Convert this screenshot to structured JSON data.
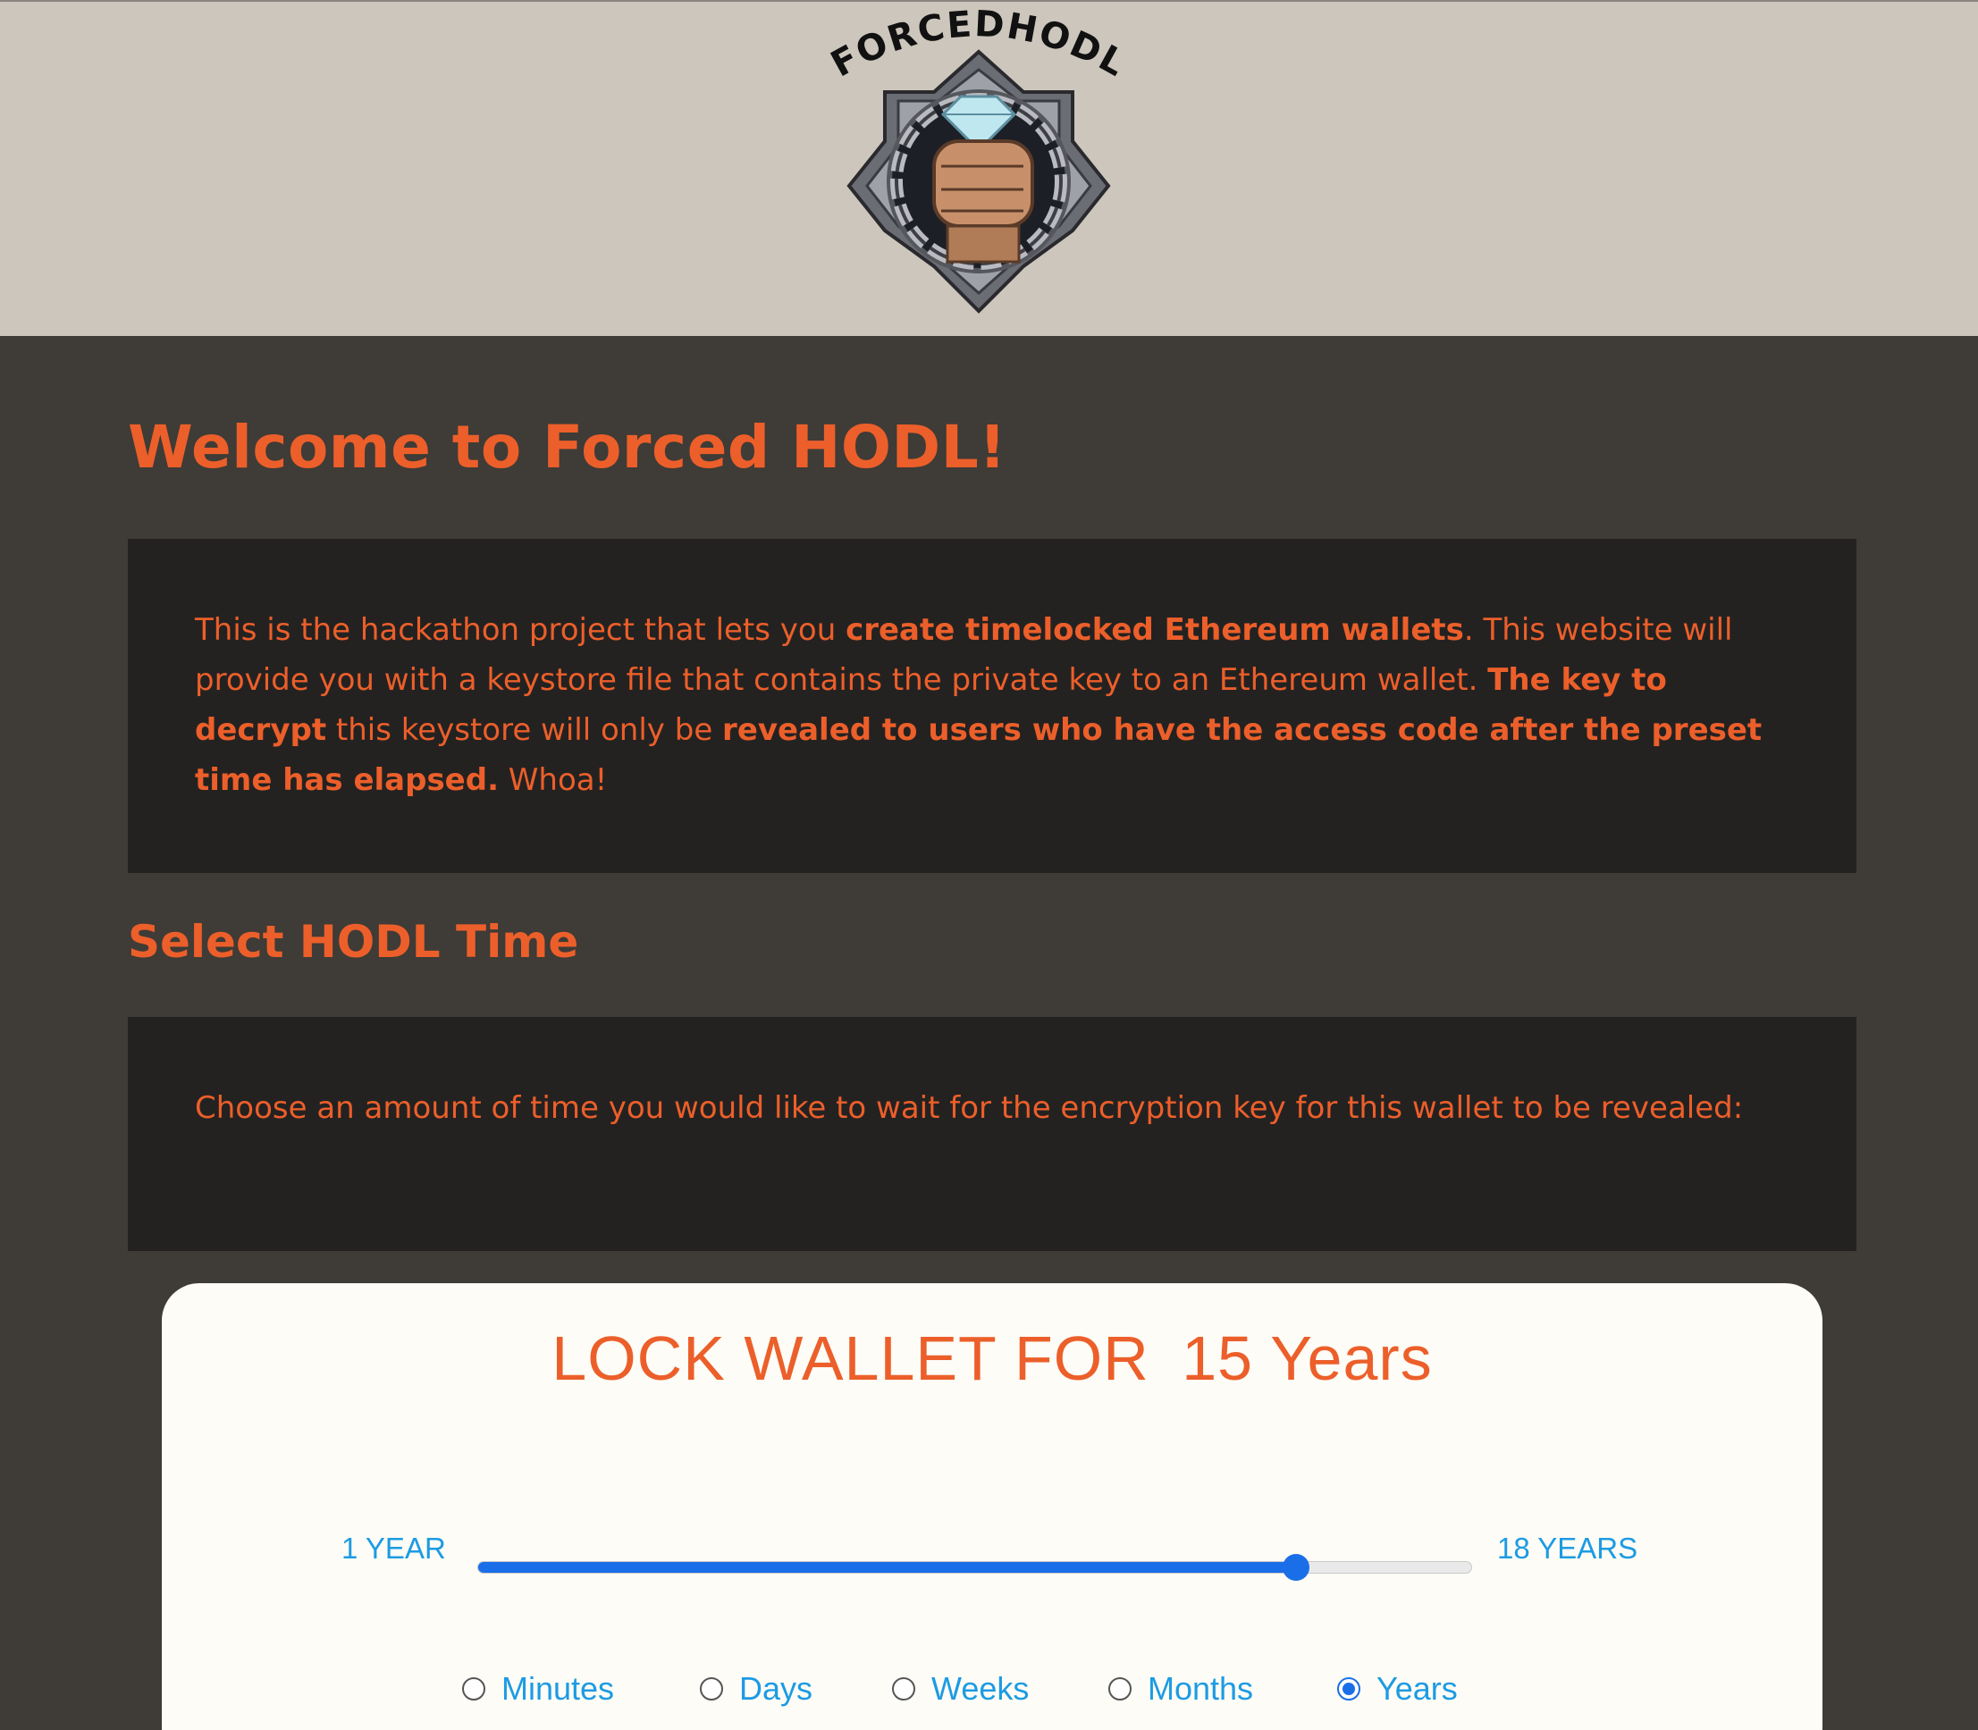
{
  "header": {
    "logo_text": "FORCEDHODL"
  },
  "main": {
    "title": "Welcome to Forced HODL!",
    "intro": {
      "p1": "This is the hackathon project that lets you ",
      "b1": "create timelocked Ethereum wallets",
      "p2": ". This website will provide you with a keystore file that contains the private key to an Ethereum wallet. ",
      "b2": "The key to decrypt",
      "p3": " this keystore will only be ",
      "b3": "revealed to users who have the access code after the preset time has elapsed.",
      "p4": " Whoa!"
    },
    "section_title": "Select HODL Time",
    "choose_text": "Choose an amount of time you would like to wait for the encryption key for this wallet to be revealed:"
  },
  "lock": {
    "heading_prefix": "LOCK WALLET FOR",
    "heading_value": "15 Years",
    "slider": {
      "min_label": "1 YEAR",
      "max_label": "18 YEARS",
      "min": 1,
      "max": 18,
      "value": 15
    },
    "units": [
      {
        "label": "Minutes",
        "checked": false
      },
      {
        "label": "Days",
        "checked": false
      },
      {
        "label": "Weeks",
        "checked": false
      },
      {
        "label": "Months",
        "checked": false
      },
      {
        "label": "Years",
        "checked": true
      }
    ]
  },
  "colors": {
    "accent": "#ec5f2a",
    "link": "#1d9be3",
    "slider": "#1a6fe8",
    "header_bg": "#ccc6bc",
    "page_bg": "#3f3b36",
    "panel_bg": "#242221"
  }
}
